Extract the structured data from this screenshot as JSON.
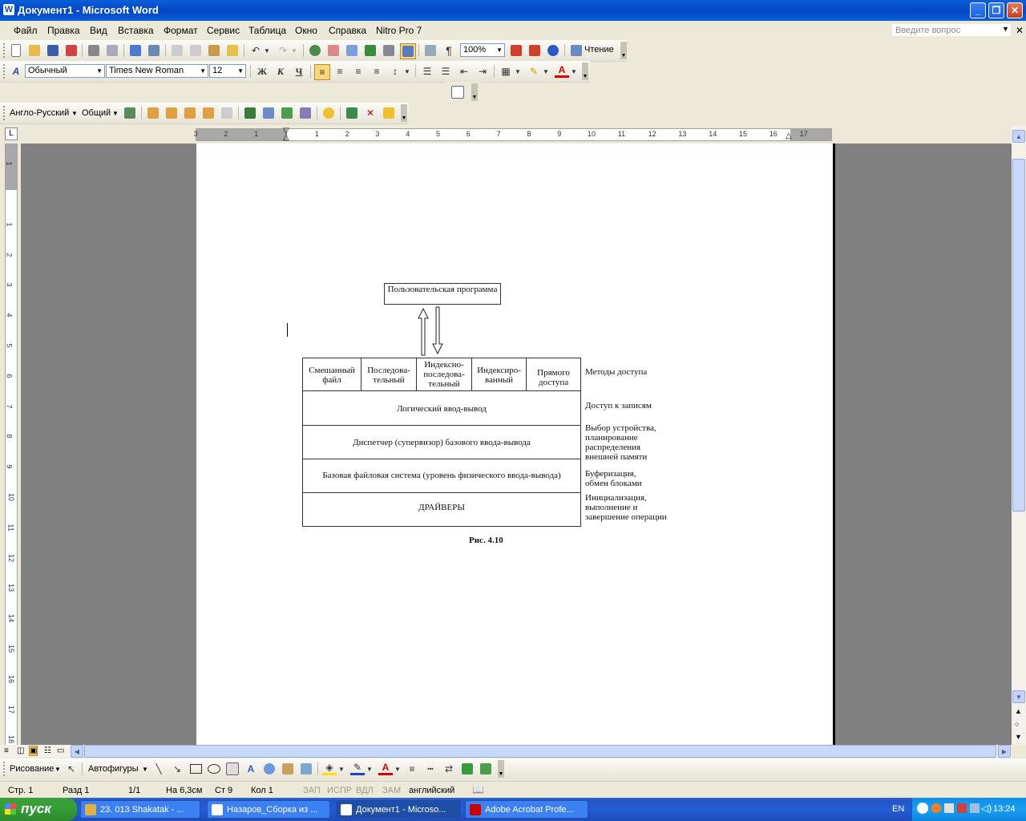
{
  "window": {
    "title": "Документ1 - Microsoft Word",
    "app_icon": "W",
    "controls": {
      "minimize": "_",
      "maximize": "❐",
      "close": "✕"
    }
  },
  "menubar": {
    "items": [
      "Файл",
      "Правка",
      "Вид",
      "Вставка",
      "Формат",
      "Сервис",
      "Таблица",
      "Окно",
      "Справка",
      "Nitro Pro 7"
    ],
    "help_placeholder": "Введите вопрос",
    "doc_close": "✕"
  },
  "standard_toolbar": {
    "zoom": "100%",
    "reading_label": "Чтение"
  },
  "formatting_toolbar": {
    "style": "Обычный",
    "font": "Times New Roman",
    "size": "12",
    "bold": "Ж",
    "italic": "К",
    "underline": "Ч"
  },
  "translation_toolbar": {
    "direction": "Англо-Русский",
    "dictionary": "Общий"
  },
  "ruler": {
    "left_labels": [
      "3",
      "2",
      "1"
    ],
    "right_labels": [
      "1",
      "2",
      "3",
      "4",
      "5",
      "6",
      "7",
      "8",
      "9",
      "10",
      "11",
      "12",
      "13",
      "14",
      "15",
      "16",
      "17"
    ],
    "vertical_labels": [
      "1",
      "1",
      "2",
      "3",
      "4",
      "5",
      "6",
      "7",
      "8",
      "9",
      "10",
      "11",
      "12",
      "13",
      "14",
      "15",
      "16",
      "17",
      "18"
    ]
  },
  "diagram": {
    "top_box": "Пользовательская программа",
    "methods": [
      "Смешанный файл",
      "Последова-тельный",
      "Индексно-последова-тельный",
      "Индексиро-ванный",
      "Прямого доступа"
    ],
    "layers": [
      "Логический ввод-вывод",
      "Диспетчер (супервизор) базового ввода-вывода",
      "Базовая файловая система (уровень физического ввода-вывода)",
      "ДРАЙВЕРЫ"
    ],
    "side_labels": [
      "Методы доступа",
      "Доступ к записям",
      "Выбор устройства, планирование распределения внешней памяти",
      "Буферизация, обмен блоками",
      "Инициализация, выполнение и завершение операции"
    ],
    "caption": "Рис. 4.10"
  },
  "drawing_toolbar": {
    "draw_label": "Рисование",
    "autoshapes_label": "Автофигуры"
  },
  "statusbar": {
    "page": "Стр. 1",
    "section": "Разд 1",
    "pages": "1/1",
    "at": "На 6,3см",
    "line": "Ст 9",
    "col": "Кол 1",
    "rec": "ЗАП",
    "trk": "ИСПР",
    "ext": "ВДЛ",
    "ovr": "ЗАМ",
    "language": "английский"
  },
  "taskbar": {
    "start_label": "пуск",
    "tasks": [
      "23. 013   Shakatak - ...",
      "Назаров_Сборка из ...",
      "Документ1 - Microso...",
      "Adobe Acrobat Profe..."
    ],
    "lang": "EN",
    "clock": "13:24"
  },
  "colors": {
    "titlebar": "#0a5fd9",
    "workspace_gray": "#808080",
    "start_green": "#35a035",
    "taskbar_blue": "#245dd7"
  }
}
